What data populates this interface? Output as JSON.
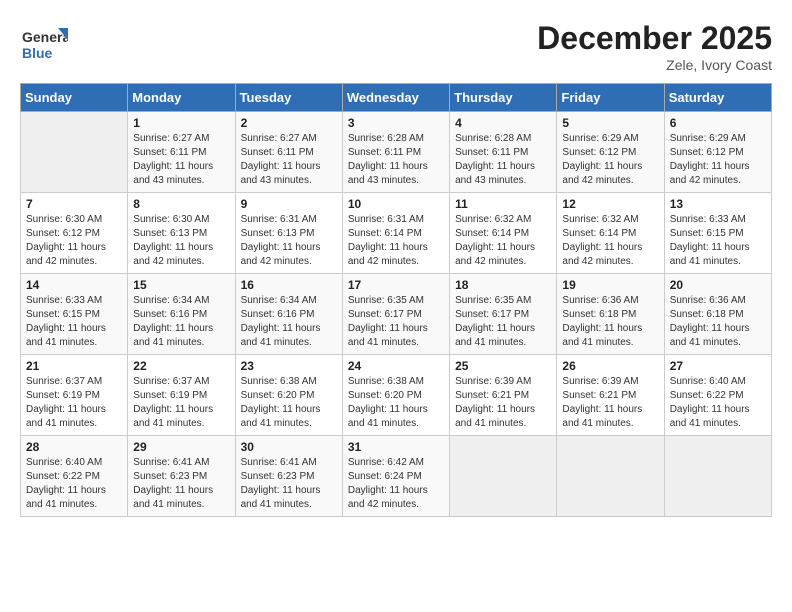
{
  "header": {
    "logo_text_top": "General",
    "logo_text_bottom": "Blue",
    "title": "December 2025",
    "subtitle": "Zele, Ivory Coast"
  },
  "calendar": {
    "days_of_week": [
      "Sunday",
      "Monday",
      "Tuesday",
      "Wednesday",
      "Thursday",
      "Friday",
      "Saturday"
    ],
    "weeks": [
      [
        {
          "day": "",
          "empty": true
        },
        {
          "day": "1",
          "sunrise": "6:27 AM",
          "sunset": "6:11 PM",
          "daylight": "11 hours and 43 minutes."
        },
        {
          "day": "2",
          "sunrise": "6:27 AM",
          "sunset": "6:11 PM",
          "daylight": "11 hours and 43 minutes."
        },
        {
          "day": "3",
          "sunrise": "6:28 AM",
          "sunset": "6:11 PM",
          "daylight": "11 hours and 43 minutes."
        },
        {
          "day": "4",
          "sunrise": "6:28 AM",
          "sunset": "6:11 PM",
          "daylight": "11 hours and 43 minutes."
        },
        {
          "day": "5",
          "sunrise": "6:29 AM",
          "sunset": "6:12 PM",
          "daylight": "11 hours and 42 minutes."
        },
        {
          "day": "6",
          "sunrise": "6:29 AM",
          "sunset": "6:12 PM",
          "daylight": "11 hours and 42 minutes."
        }
      ],
      [
        {
          "day": "7",
          "sunrise": "6:30 AM",
          "sunset": "6:12 PM",
          "daylight": "11 hours and 42 minutes."
        },
        {
          "day": "8",
          "sunrise": "6:30 AM",
          "sunset": "6:13 PM",
          "daylight": "11 hours and 42 minutes."
        },
        {
          "day": "9",
          "sunrise": "6:31 AM",
          "sunset": "6:13 PM",
          "daylight": "11 hours and 42 minutes."
        },
        {
          "day": "10",
          "sunrise": "6:31 AM",
          "sunset": "6:14 PM",
          "daylight": "11 hours and 42 minutes."
        },
        {
          "day": "11",
          "sunrise": "6:32 AM",
          "sunset": "6:14 PM",
          "daylight": "11 hours and 42 minutes."
        },
        {
          "day": "12",
          "sunrise": "6:32 AM",
          "sunset": "6:14 PM",
          "daylight": "11 hours and 42 minutes."
        },
        {
          "day": "13",
          "sunrise": "6:33 AM",
          "sunset": "6:15 PM",
          "daylight": "11 hours and 41 minutes."
        }
      ],
      [
        {
          "day": "14",
          "sunrise": "6:33 AM",
          "sunset": "6:15 PM",
          "daylight": "11 hours and 41 minutes."
        },
        {
          "day": "15",
          "sunrise": "6:34 AM",
          "sunset": "6:16 PM",
          "daylight": "11 hours and 41 minutes."
        },
        {
          "day": "16",
          "sunrise": "6:34 AM",
          "sunset": "6:16 PM",
          "daylight": "11 hours and 41 minutes."
        },
        {
          "day": "17",
          "sunrise": "6:35 AM",
          "sunset": "6:17 PM",
          "daylight": "11 hours and 41 minutes."
        },
        {
          "day": "18",
          "sunrise": "6:35 AM",
          "sunset": "6:17 PM",
          "daylight": "11 hours and 41 minutes."
        },
        {
          "day": "19",
          "sunrise": "6:36 AM",
          "sunset": "6:18 PM",
          "daylight": "11 hours and 41 minutes."
        },
        {
          "day": "20",
          "sunrise": "6:36 AM",
          "sunset": "6:18 PM",
          "daylight": "11 hours and 41 minutes."
        }
      ],
      [
        {
          "day": "21",
          "sunrise": "6:37 AM",
          "sunset": "6:19 PM",
          "daylight": "11 hours and 41 minutes."
        },
        {
          "day": "22",
          "sunrise": "6:37 AM",
          "sunset": "6:19 PM",
          "daylight": "11 hours and 41 minutes."
        },
        {
          "day": "23",
          "sunrise": "6:38 AM",
          "sunset": "6:20 PM",
          "daylight": "11 hours and 41 minutes."
        },
        {
          "day": "24",
          "sunrise": "6:38 AM",
          "sunset": "6:20 PM",
          "daylight": "11 hours and 41 minutes."
        },
        {
          "day": "25",
          "sunrise": "6:39 AM",
          "sunset": "6:21 PM",
          "daylight": "11 hours and 41 minutes."
        },
        {
          "day": "26",
          "sunrise": "6:39 AM",
          "sunset": "6:21 PM",
          "daylight": "11 hours and 41 minutes."
        },
        {
          "day": "27",
          "sunrise": "6:40 AM",
          "sunset": "6:22 PM",
          "daylight": "11 hours and 41 minutes."
        }
      ],
      [
        {
          "day": "28",
          "sunrise": "6:40 AM",
          "sunset": "6:22 PM",
          "daylight": "11 hours and 41 minutes."
        },
        {
          "day": "29",
          "sunrise": "6:41 AM",
          "sunset": "6:23 PM",
          "daylight": "11 hours and 41 minutes."
        },
        {
          "day": "30",
          "sunrise": "6:41 AM",
          "sunset": "6:23 PM",
          "daylight": "11 hours and 41 minutes."
        },
        {
          "day": "31",
          "sunrise": "6:42 AM",
          "sunset": "6:24 PM",
          "daylight": "11 hours and 42 minutes."
        },
        {
          "day": "",
          "empty": true
        },
        {
          "day": "",
          "empty": true
        },
        {
          "day": "",
          "empty": true
        }
      ]
    ]
  }
}
